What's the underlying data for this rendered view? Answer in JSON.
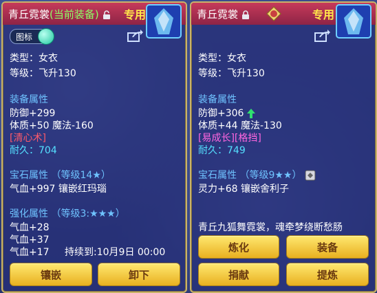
{
  "left": {
    "title_name": "青丘霓裳",
    "title_tag": "(当前装备)",
    "special": "专用",
    "toggle_label": "图标",
    "type": "类型：女衣",
    "level": "等级：飞升130",
    "attr_header": "装备属性",
    "defense": "防御+299",
    "stats": "体质+50 魔法-160",
    "skill": "[清心术]",
    "durability": "耐久：704",
    "gem_header": "宝石属性 （等级14★）",
    "gem_value": "气血+997 镶嵌红玛瑙",
    "enhance_header": "强化属性 （等级3:★★★）",
    "enhance_1": "气血+28",
    "enhance_2": "气血+37",
    "enhance_3": "气血+17",
    "duration": "持续到:10月9日 00:00",
    "btn_inlay": "镶嵌",
    "btn_unequip": "卸下"
  },
  "right": {
    "title_name": "青丘霓裳",
    "special": "专用",
    "type": "类型：女衣",
    "level": "等级：飞升130",
    "attr_header": "装备属性",
    "defense": "防御+306",
    "stats": "体质+44 魔法-130",
    "skill": "[易成长][格挡]",
    "durability": "耐久：749",
    "gem_header": "宝石属性 （等级9★★）",
    "gem_value": "灵力+68 镶嵌舍利子",
    "description": "青丘九狐舞霓裳，魂牵梦绕断愁肠",
    "btn_refine": "炼化",
    "btn_equip": "装备",
    "btn_donate": "捐献",
    "btn_extract": "提炼"
  }
}
